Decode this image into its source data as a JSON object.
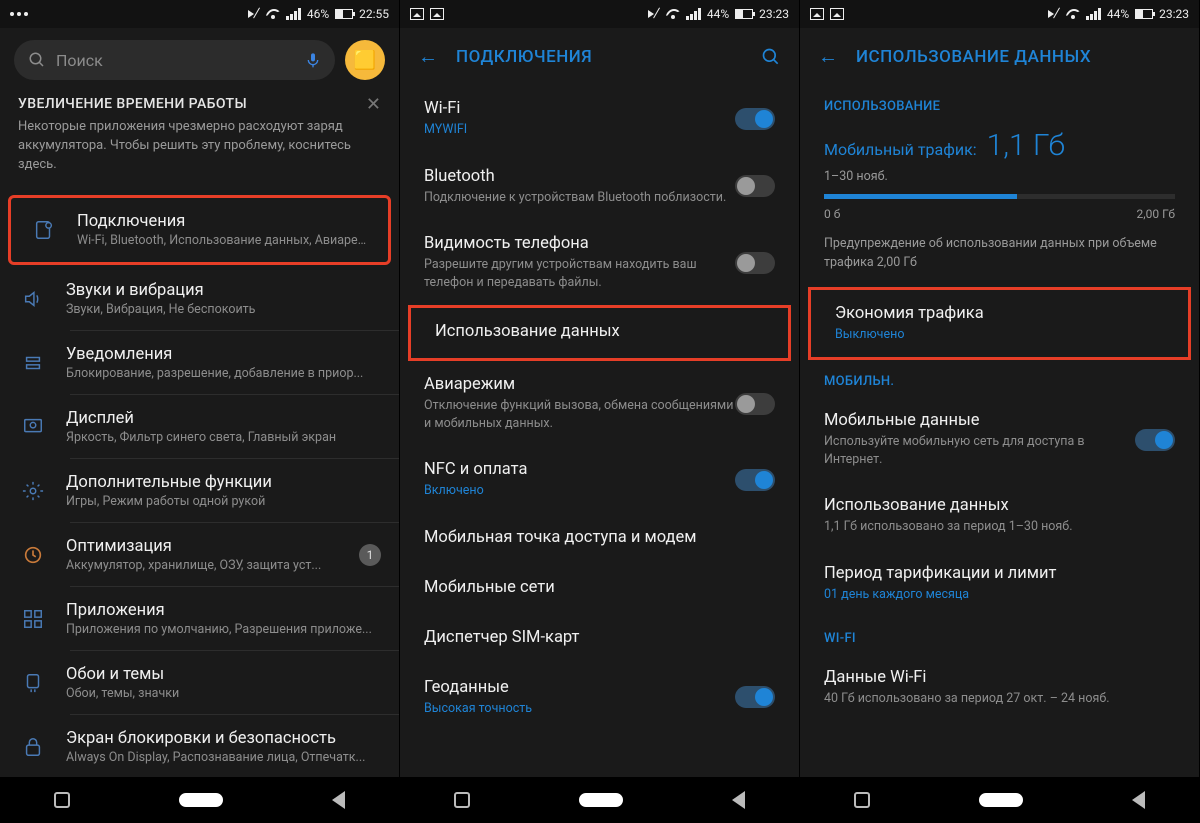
{
  "screen1": {
    "status": {
      "battery_pct": "46%",
      "time": "22:55"
    },
    "search_placeholder": "Поиск",
    "banner": {
      "title": "УВЕЛИЧЕНИЕ ВРЕМЕНИ РАБОТЫ",
      "body": "Некоторые приложения чрезмерно расходуют заряд аккумулятора. Чтобы решить эту проблему, коснитесь здесь."
    },
    "items": [
      {
        "title": "Подключения",
        "sub": "Wi-Fi, Bluetooth, Использование данных, Авиареж..."
      },
      {
        "title": "Звуки и вибрация",
        "sub": "Звуки, Вибрация, Не беспокоить"
      },
      {
        "title": "Уведомления",
        "sub": "Блокирование, разрешение, добавление в приор..."
      },
      {
        "title": "Дисплей",
        "sub": "Яркость, Фильтр синего света, Главный экран"
      },
      {
        "title": "Дополнительные функции",
        "sub": "Игры, Режим работы одной рукой"
      },
      {
        "title": "Оптимизация",
        "sub": "Аккумулятор, хранилище, ОЗУ, защита уст...",
        "badge": "1"
      },
      {
        "title": "Приложения",
        "sub": "Приложения по умолчанию, Разрешения приложе..."
      },
      {
        "title": "Обои и темы",
        "sub": "Обои, темы, значки"
      },
      {
        "title": "Экран блокировки и безопасность",
        "sub": "Always On Display, Распознавание лица, Отпечатк..."
      }
    ]
  },
  "screen2": {
    "status": {
      "battery_pct": "44%",
      "time": "23:23"
    },
    "title": "ПОДКЛЮЧЕНИЯ",
    "items": [
      {
        "title": "Wi-Fi",
        "sub": "MYWIFI",
        "sub_link": true,
        "toggle": "on"
      },
      {
        "title": "Bluetooth",
        "sub": "Подключение к устройствам Bluetooth поблизости.",
        "toggle": "off"
      },
      {
        "title": "Видимость телефона",
        "sub": "Разрешите другим устройствам находить ваш телефон и передавать файлы.",
        "toggle": "off"
      },
      {
        "title": "Использование данных"
      },
      {
        "title": "Авиарежим",
        "sub": "Отключение функций вызова, обмена сообщениями и мобильных данных.",
        "toggle": "off"
      },
      {
        "title": "NFC и оплата",
        "sub": "Включено",
        "sub_link": true,
        "toggle": "on"
      },
      {
        "title": "Мобильная точка доступа и модем"
      },
      {
        "title": "Мобильные сети"
      },
      {
        "title": "Диспетчер SIM-карт"
      },
      {
        "title": "Геоданные",
        "sub": "Высокая точность",
        "sub_link": true,
        "toggle": "on"
      }
    ]
  },
  "screen3": {
    "status": {
      "battery_pct": "44%",
      "time": "23:23"
    },
    "title": "ИСПОЛЬЗОВАНИЕ ДАННЫХ",
    "section_usage": "ИСПОЛЬЗОВАНИЕ",
    "usage_label": "Мобильный трафик:",
    "usage_value": "1,1 Гб",
    "usage_period": "1–30 нояб.",
    "scale_min": "0 б",
    "scale_max": "2,00 Гб",
    "usage_warn": "Предупреждение об использовании данных при объеме трафика 2,00 Гб",
    "saver": {
      "title": "Экономия трафика",
      "sub": "Выключено"
    },
    "section_mobile": "МОБИЛЬН.",
    "mobile_data": {
      "title": "Мобильные данные",
      "sub": "Используйте мобильную сеть для доступа в Интернет."
    },
    "data_usage": {
      "title": "Использование данных",
      "sub": "1,1 Гб использовано за период 1–30 нояб."
    },
    "billing": {
      "title": "Период тарификации и лимит",
      "sub": "01 день каждого месяца"
    },
    "section_wifi": "WI-FI",
    "wifi_data": {
      "title": "Данные Wi-Fi",
      "sub": "40 Гб использовано за период 27 окт. – 24 нояб."
    }
  }
}
